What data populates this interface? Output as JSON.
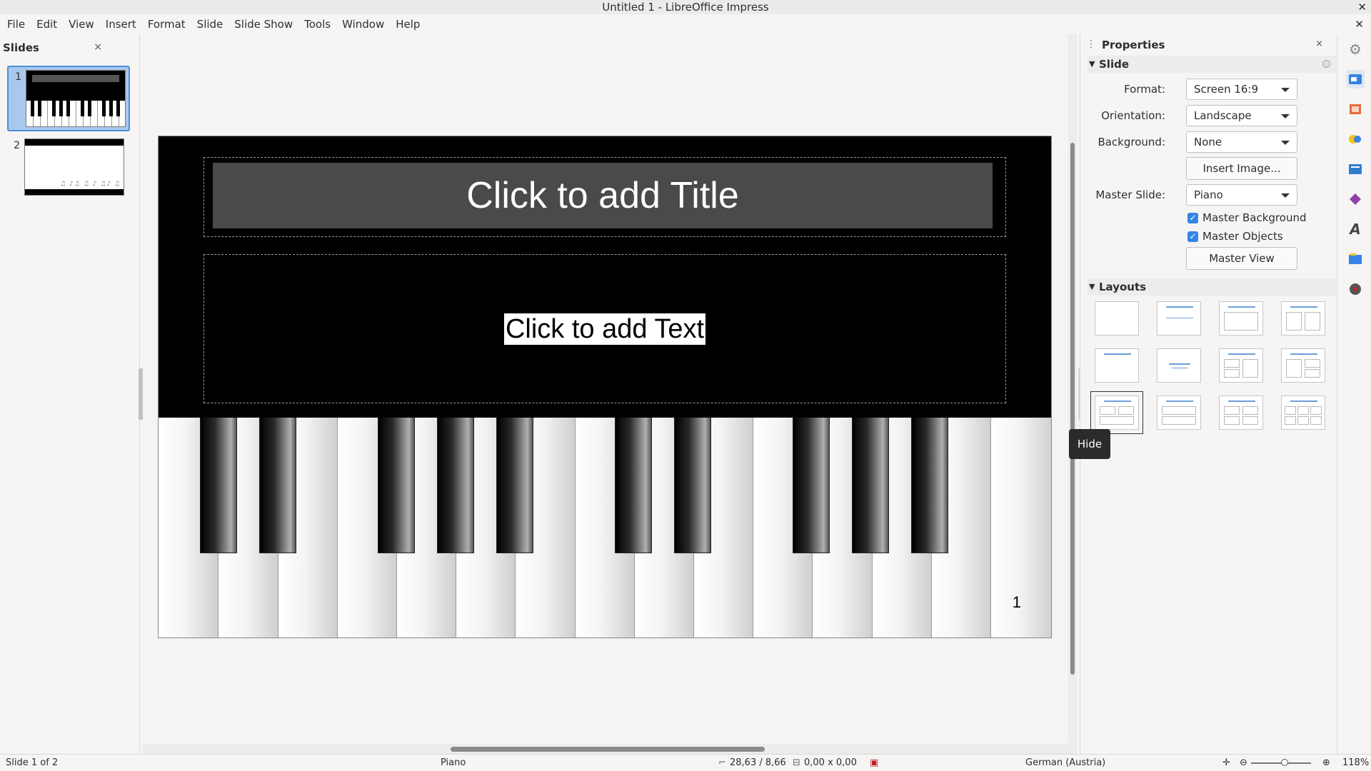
{
  "window": {
    "title": "Untitled 1 - LibreOffice Impress",
    "close_glyph": "✕"
  },
  "menu": {
    "items": [
      {
        "label": "File"
      },
      {
        "label": "Edit"
      },
      {
        "label": "View"
      },
      {
        "label": "Insert"
      },
      {
        "label": "Format"
      },
      {
        "label": "Slide"
      },
      {
        "label": "Slide Show"
      },
      {
        "label": "Tools"
      },
      {
        "label": "Window"
      },
      {
        "label": "Help"
      }
    ],
    "doc_close_glyph": "✕"
  },
  "slides_pane": {
    "title": "Slides",
    "close_glyph": "×",
    "slides": [
      {
        "number": "1",
        "selected": true
      },
      {
        "number": "2",
        "selected": false
      }
    ],
    "thumb2_notes": "♫ ♪♫ ♫ ♪ ♫♪ ♫"
  },
  "slide": {
    "title_placeholder": "Click to add Title",
    "text_placeholder": "Click to add Text",
    "page_number": "1"
  },
  "properties": {
    "title": "Properties",
    "grip_glyph": "⋮",
    "close_glyph": "×",
    "slide_section": {
      "header": "Slide",
      "format_label": "Format:",
      "format_value": "Screen 16:9",
      "orientation_label": "Orientation:",
      "orientation_value": "Landscape",
      "background_label": "Background:",
      "background_value": "None",
      "insert_image_button": "Insert Image...",
      "master_slide_label": "Master Slide:",
      "master_slide_value": "Piano",
      "master_background_label": "Master Background",
      "master_background_checked": true,
      "master_objects_label": "Master Objects",
      "master_objects_checked": true,
      "master_view_button": "Master View"
    },
    "layouts_section": {
      "header": "Layouts",
      "selected_index": 8
    }
  },
  "tooltip": {
    "text": "Hide"
  },
  "tabbar": {
    "icons": [
      "gear-icon",
      "properties-icon",
      "slide-transition-icon",
      "animation-icon",
      "master-slides-icon",
      "shapes-icon",
      "styles-icon",
      "gallery-icon",
      "navigator-icon"
    ]
  },
  "statusbar": {
    "slide_info": "Slide 1 of 2",
    "master": "Piano",
    "position": "28,63 / 8,66",
    "size": "0,00 x 0,00",
    "language": "German (Austria)",
    "zoom": "118%"
  },
  "colors": {
    "accent": "#3584e4",
    "selection": "#a9c8ee",
    "slide_background": "#000000"
  }
}
